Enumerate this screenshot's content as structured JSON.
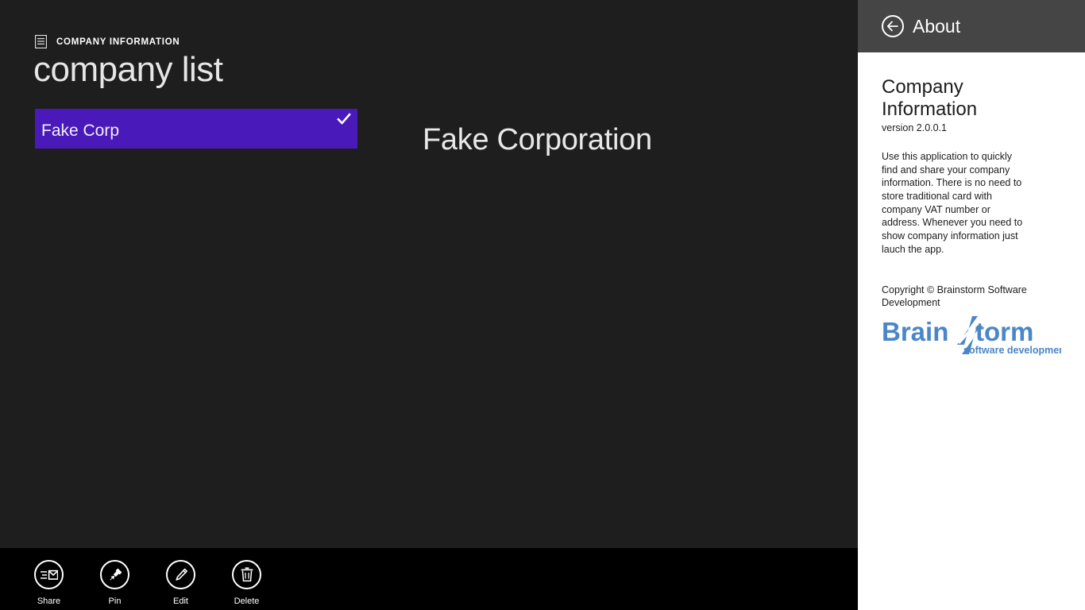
{
  "app": {
    "kicker": "COMPANY INFORMATION",
    "kicker_icon": "list-document-icon",
    "page_title": "company list",
    "list": {
      "items": [
        {
          "label": "Fake Corp",
          "selected": true,
          "accent": "#4a19b9",
          "check_icon": "checkmark-icon"
        }
      ]
    },
    "detail": {
      "title": "Fake Corporation"
    },
    "appbar": {
      "commands": [
        {
          "label": "Share",
          "icon": "share-mail-icon"
        },
        {
          "label": "Pin",
          "icon": "pushpin-icon"
        },
        {
          "label": "Edit",
          "icon": "pencil-icon"
        },
        {
          "label": "Delete",
          "icon": "trash-icon"
        }
      ]
    },
    "colors": {
      "background": "#1e1e1e",
      "appbar_background": "#000000",
      "accent": "#4a19b9"
    }
  },
  "flyout": {
    "title": "About",
    "back_icon": "back-arrow-icon",
    "header_color": "#454545",
    "about_title": "Company Information",
    "version": "version 2.0.0.1",
    "description": "Use this application to quickly find and share your company information. There is no need to store traditional card with company VAT number or address. Whenever you need to show company information just lauch the app.",
    "copyright": "Copyright © Brainstorm Software Development",
    "logo": {
      "name": "brainstorm-logo",
      "text_before": "Brain",
      "text_after": "torm",
      "tagline": "software development",
      "color": "#4a86c8"
    }
  }
}
